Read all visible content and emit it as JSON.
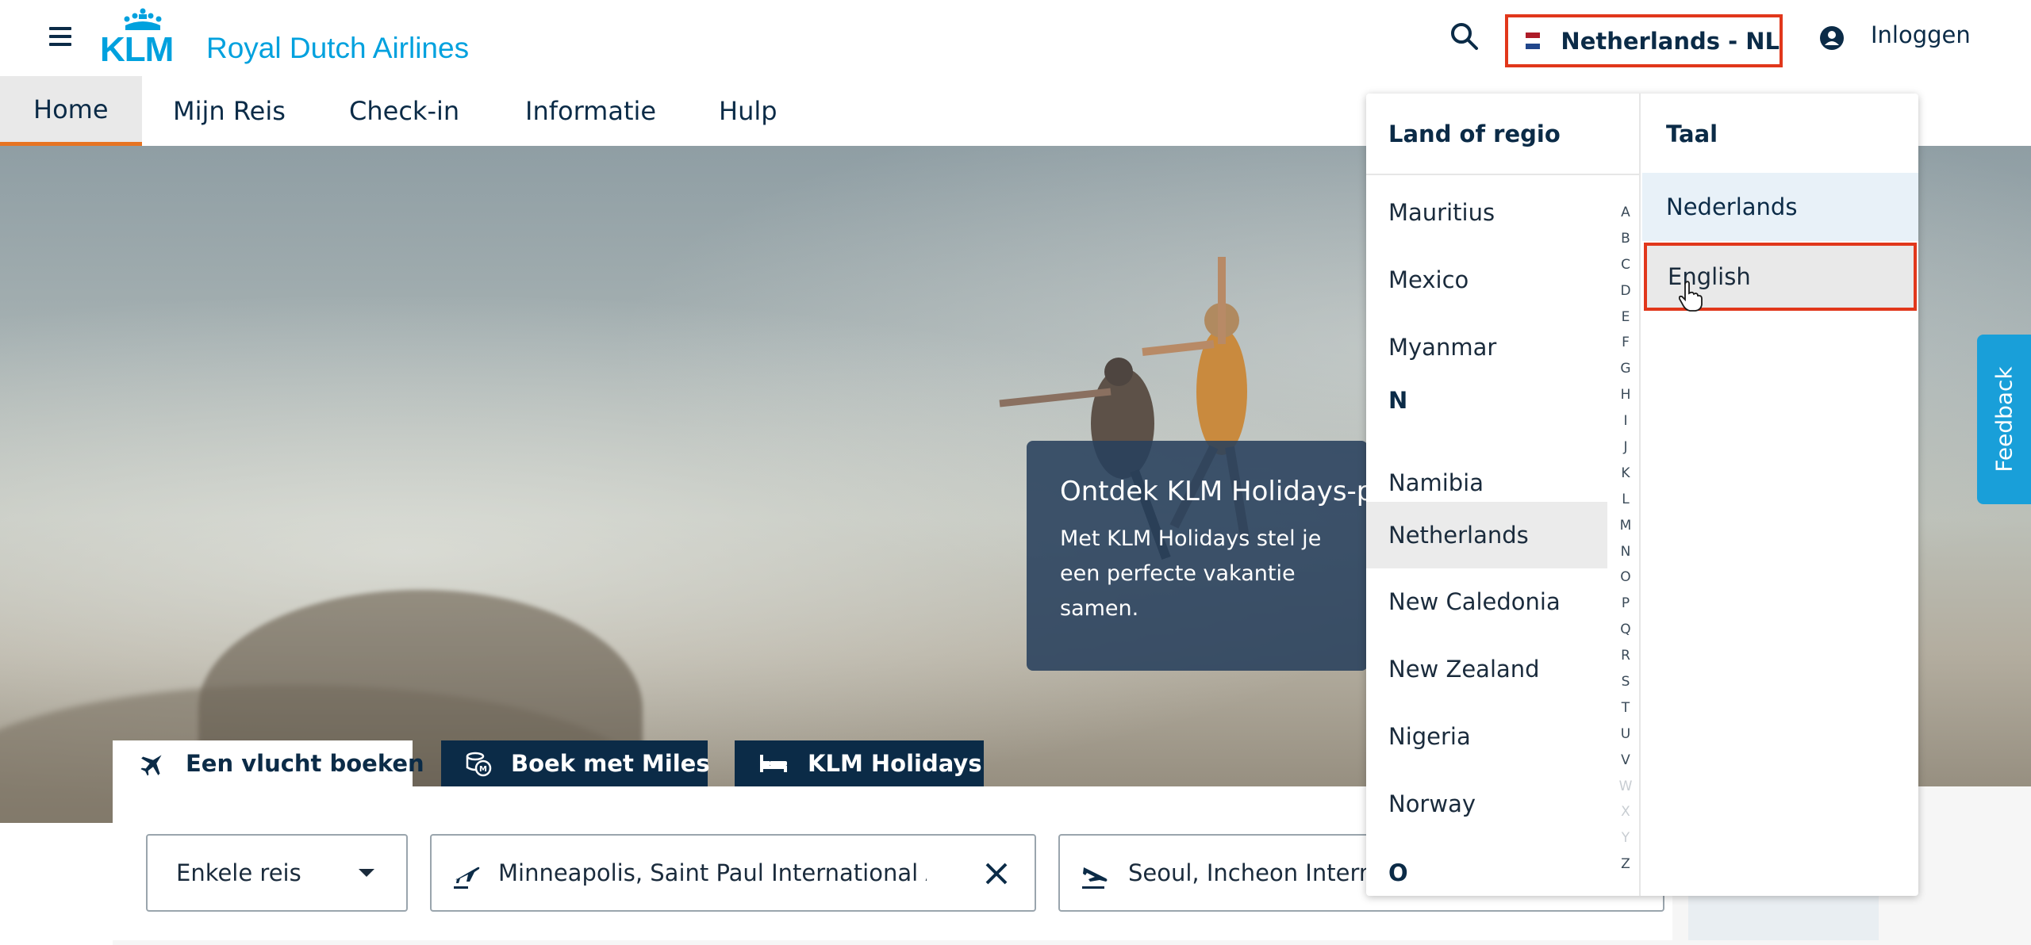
{
  "header": {
    "logo_text": "KLM",
    "brand_name": "Royal Dutch Airlines",
    "country_selector": "Netherlands - NL",
    "login_label": "Inloggen",
    "flag_colors": [
      "#ae1c28",
      "#ffffff",
      "#21468b"
    ]
  },
  "nav": {
    "tabs": [
      {
        "label": "Home",
        "active": true
      },
      {
        "label": "Mijn Reis"
      },
      {
        "label": "Check-in"
      },
      {
        "label": "Informatie"
      },
      {
        "label": "Hulp"
      }
    ]
  },
  "hero": {
    "promo_title": "Ontdek KLM Holidays-pakketten",
    "promo_text": "Met KLM Holidays stel je een perfecte vakantie samen."
  },
  "feedback_label": "Feedback",
  "booking": {
    "tabs": [
      {
        "label": "Een vlucht boeken",
        "icon": "plane-icon",
        "active": true
      },
      {
        "label": "Boek met Miles",
        "icon": "miles-coins-icon"
      },
      {
        "label": "KLM Holidays",
        "icon": "bed-icon"
      }
    ],
    "trip_type": "Enkele reis",
    "from": "Minneapolis, Saint Paul International Airport",
    "to": "Seoul, Incheon International Airport"
  },
  "dropdown": {
    "country_heading": "Land of regio",
    "language_heading": "Taal",
    "countries": [
      {
        "name": "Mauritius"
      },
      {
        "name": "Mexico"
      },
      {
        "name": "Myanmar"
      },
      {
        "header": "N"
      },
      {
        "name": "Namibia"
      },
      {
        "name": "Netherlands",
        "selected": true
      },
      {
        "name": "New Caledonia"
      },
      {
        "name": "New Zealand"
      },
      {
        "name": "Nigeria"
      },
      {
        "name": "Norway"
      },
      {
        "header": "O"
      }
    ],
    "alphabet": [
      "A",
      "B",
      "C",
      "D",
      "E",
      "F",
      "G",
      "H",
      "I",
      "J",
      "K",
      "L",
      "M",
      "N",
      "O",
      "P",
      "Q",
      "R",
      "S",
      "T",
      "U",
      "V",
      "W",
      "X",
      "Y",
      "Z"
    ],
    "alphabet_disabled": [
      "W",
      "X",
      "Y"
    ],
    "languages": [
      {
        "label": "Nederlands",
        "current": true
      },
      {
        "label": "English",
        "hovered": true
      }
    ]
  },
  "colors": {
    "brand_blue": "#00a1de",
    "navy": "#0b2b47",
    "highlight_red": "#e1371b",
    "active_tab_underline": "#e77422",
    "feedback_blue": "#199fd9"
  }
}
